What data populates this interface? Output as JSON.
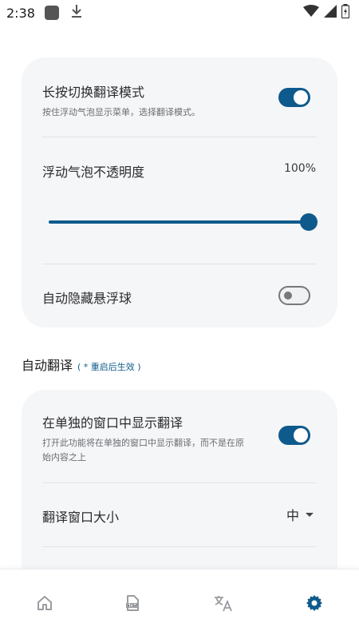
{
  "status_bar": {
    "time": "2:38",
    "icons": [
      "app-icon",
      "download-icon",
      "wifi-icon",
      "signal-icon",
      "battery-charging-icon"
    ]
  },
  "settings_card_1": {
    "long_press": {
      "title": "长按切换翻译模式",
      "subtitle": "按住浮动气泡显示菜单，选择翻译模式。",
      "enabled": true
    },
    "opacity": {
      "title": "浮动气泡不透明度",
      "value_text": "100%",
      "value": 1.0
    },
    "auto_hide": {
      "title": "自动隐藏悬浮球",
      "enabled": false
    }
  },
  "auto_translate_section": {
    "title": "自动翻译",
    "note": "( * 重启后生效 )"
  },
  "settings_card_2": {
    "separate_window": {
      "title": "在单独的窗口中显示翻译",
      "subtitle": "打开此功能将在单独的窗口中显示翻译，而不是在原始内容之上",
      "enabled": true
    },
    "window_size": {
      "title": "翻译窗口大小",
      "value": "中"
    }
  },
  "bottom_nav": {
    "items": [
      "home-icon",
      "pdf-icon",
      "translate-icon",
      "settings-icon"
    ],
    "active_index": 3
  },
  "colors": {
    "accent": "#0f5a8c",
    "card_bg": "#f5f6f8",
    "nav_inactive": "#9a9ca1"
  }
}
